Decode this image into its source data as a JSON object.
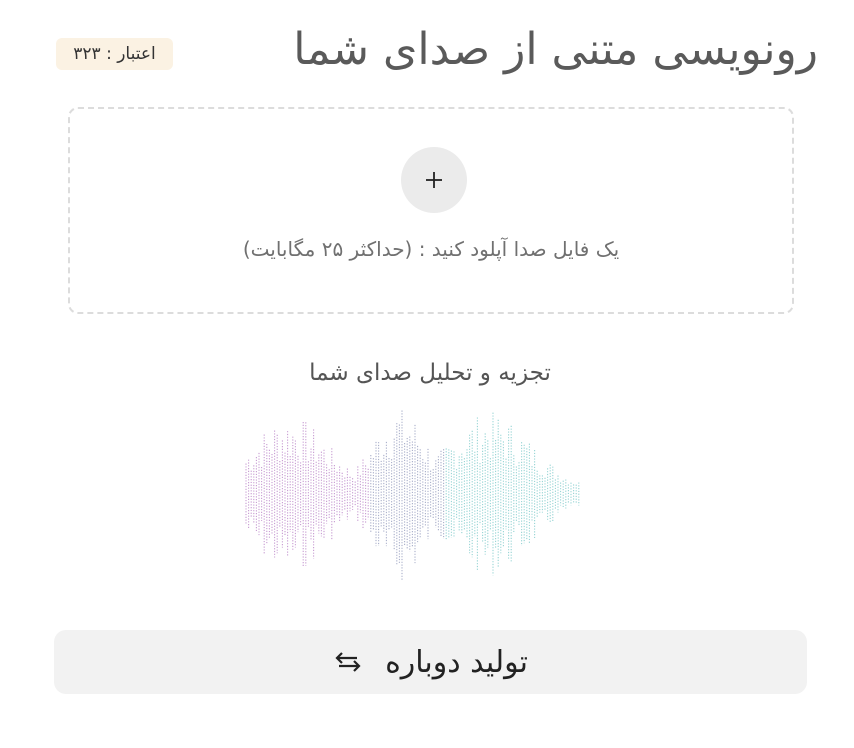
{
  "header": {
    "title": "رونویسی متنی از صدای شما",
    "credit_label": "اعتبار : ۳۲۳"
  },
  "upload": {
    "plus_icon": "plus-icon",
    "instruction": "یک فایل صدا آپلود کنید : (حداکثر ۲۵ مگابایت)"
  },
  "analysis": {
    "title": "تجزیه و تحلیل صدای شما",
    "wave_colors": [
      "#b57bc4",
      "#8c93b7",
      "#74c6c6"
    ]
  },
  "action": {
    "regenerate_label": "تولید دوباره",
    "regenerate_icon": "swap-arrows-icon"
  }
}
